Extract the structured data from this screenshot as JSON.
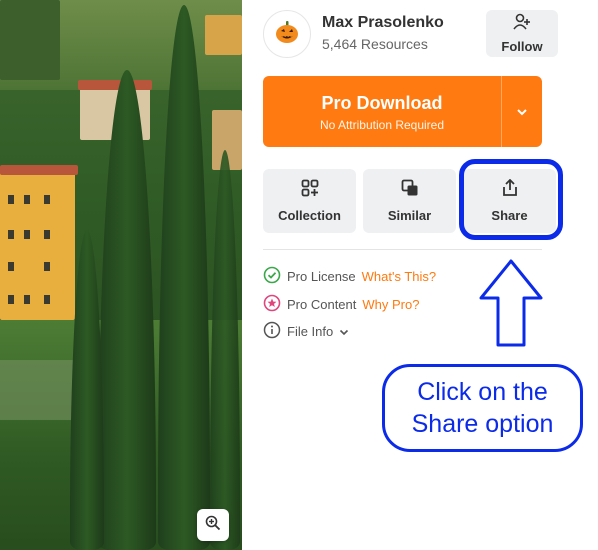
{
  "author": {
    "name": "Max Prasolenko",
    "resources": "5,464 Resources",
    "avatar_icon": "pumpkin-icon"
  },
  "follow": {
    "label": "Follow",
    "icon": "add-user-icon"
  },
  "download": {
    "label": "Pro Download",
    "sublabel": "No Attribution Required",
    "color": "#ff7a10",
    "caret_icon": "chevron-down-icon"
  },
  "actions": [
    {
      "label": "Collection",
      "icon": "collection-icon"
    },
    {
      "label": "Similar",
      "icon": "similar-icon"
    },
    {
      "label": "Share",
      "icon": "share-icon"
    }
  ],
  "info": {
    "license": {
      "label": "Pro License",
      "link": "What's This?"
    },
    "content": {
      "label": "Pro Content",
      "link": "Why Pro?"
    },
    "file": {
      "label": "File Info"
    }
  },
  "annotation": {
    "text": "Click on the\nShare option",
    "color": "#0b2be8"
  },
  "photo": {
    "zoom_icon": "zoom-in-icon"
  }
}
